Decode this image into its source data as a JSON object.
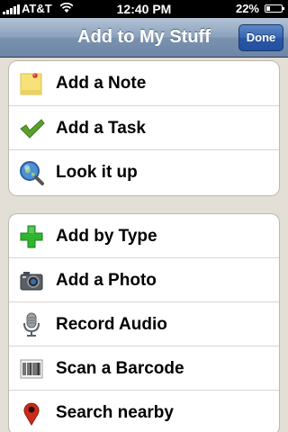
{
  "status_bar": {
    "carrier": "AT&T",
    "time": "12:40 PM",
    "battery_percent": "22%",
    "battery_level": 0.22,
    "icons": [
      "signal-icon",
      "wifi-icon",
      "battery-icon"
    ]
  },
  "nav": {
    "title": "Add to My Stuff",
    "done_label": "Done"
  },
  "groups": [
    {
      "items": [
        {
          "label": "Add a Note",
          "icon": "note-icon"
        },
        {
          "label": "Add a Task",
          "icon": "checkmark-icon"
        },
        {
          "label": "Look it up",
          "icon": "magnifier-globe-icon"
        }
      ]
    },
    {
      "items": [
        {
          "label": "Add by Type",
          "icon": "plus-icon"
        },
        {
          "label": "Add a Photo",
          "icon": "camera-icon"
        },
        {
          "label": "Record Audio",
          "icon": "microphone-icon"
        },
        {
          "label": "Scan a Barcode",
          "icon": "barcode-icon"
        },
        {
          "label": "Search nearby",
          "icon": "map-pin-icon"
        }
      ]
    }
  ],
  "colors": {
    "nav_bar": "#8aa0bb",
    "done_button": "#3665b3",
    "background": "#e3dfd6",
    "checkmark": "#5aa02c",
    "plus": "#2fb52f",
    "map_pin": "#cc2a1e"
  }
}
